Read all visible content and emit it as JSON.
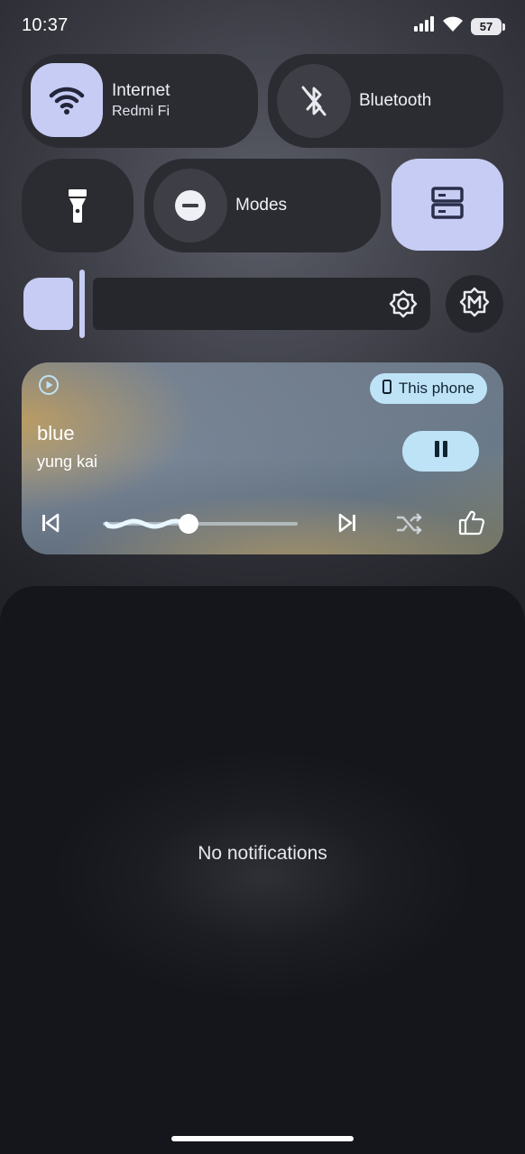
{
  "status_bar": {
    "time": "10:37",
    "battery_level": "57",
    "icons": [
      "signal-icon",
      "wifi-icon",
      "battery-icon"
    ]
  },
  "quick_settings": {
    "internet": {
      "title": "Internet",
      "subtitle": "Redmi Fi",
      "icon": "wifi-icon",
      "active": true
    },
    "bluetooth": {
      "title": "Bluetooth",
      "icon": "bluetooth-off-icon",
      "active": false
    },
    "flashlight": {
      "icon": "flashlight-icon",
      "active": false
    },
    "modes": {
      "title": "Modes",
      "icon": "do-not-disturb-icon",
      "active": false
    },
    "storage": {
      "icon": "storage-icon",
      "active": true
    }
  },
  "brightness": {
    "icon": "brightness-icon",
    "auto_icon": "auto-brightness-icon"
  },
  "media": {
    "app_icon": "play-circle-icon",
    "title": "blue",
    "artist": "yung kai",
    "output_device": "This phone",
    "progress": 0.44,
    "controls": [
      "previous-icon",
      "pause-icon",
      "next-icon",
      "shuffle-icon",
      "thumbs-up-icon"
    ]
  },
  "notifications": {
    "empty_text": "No notifications"
  },
  "colors": {
    "accent": "#c6ccf3",
    "media_accent": "#bfe3f6",
    "tile_bg": "#2b2c32"
  }
}
